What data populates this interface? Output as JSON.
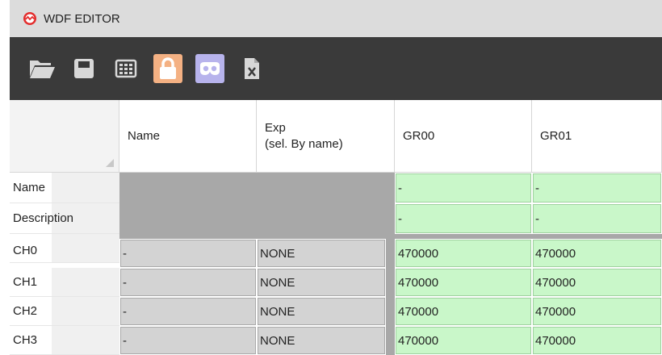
{
  "window": {
    "title": "WDF EDITOR"
  },
  "toolbar": {
    "buttons": [
      {
        "icon": "folder-open-icon"
      },
      {
        "icon": "save-icon"
      },
      {
        "icon": "grid-icon"
      },
      {
        "icon": "lock-icon",
        "color": "#f4b183"
      },
      {
        "icon": "mask-icon",
        "color": "#b7b3ec"
      },
      {
        "icon": "excel-file-icon"
      }
    ]
  },
  "grid": {
    "columns": [
      "Name",
      "Exp\n(sel. By name)",
      "GR00",
      "GR01"
    ],
    "group_rows": [
      {
        "label": "Name",
        "gr00": "-",
        "gr01": "-"
      },
      {
        "label": "Description",
        "gr00": "-",
        "gr01": "-"
      }
    ],
    "channel_rows": [
      {
        "label": "CH0",
        "name": "-",
        "exp": "NONE",
        "gr00": "470000",
        "gr01": "470000"
      },
      {
        "label": "CH1",
        "name": "-",
        "exp": "NONE",
        "gr00": "470000",
        "gr01": "470000"
      },
      {
        "label": "CH2",
        "name": "-",
        "exp": "NONE",
        "gr00": "470000",
        "gr01": "470000"
      },
      {
        "label": "CH3",
        "name": "-",
        "exp": "NONE",
        "gr00": "470000",
        "gr01": "470000"
      }
    ]
  },
  "colors": {
    "green_cell": "#c9f7c9",
    "gray_block": "#a8a8a8",
    "light_cell": "#d3d3d3",
    "toolbar_bg": "#3a3a3a"
  }
}
